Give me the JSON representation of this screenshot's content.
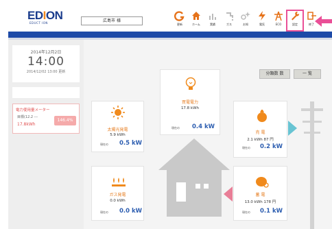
{
  "header": {
    "logo_ed": "ED",
    "logo_i": "I",
    "logo_on": "ON",
    "logo_sub": "EDUCT ION",
    "place": "広島市 様"
  },
  "nav": [
    {
      "icon": "g-refresh-icon",
      "label": "更新"
    },
    {
      "icon": "home-icon",
      "label": "ホーム"
    },
    {
      "icon": "graph-icon",
      "label": "実績"
    },
    {
      "icon": "tap-icon",
      "label": "ガス"
    },
    {
      "icon": "sparkle-icon",
      "label": "お知"
    },
    {
      "icon": "lightning-icon",
      "label": "電気"
    },
    {
      "icon": "tower-icon",
      "label": "ECO"
    },
    {
      "icon": "wrench-icon",
      "label": "設定"
    },
    {
      "icon": "exit-icon",
      "label": "終了"
    }
  ],
  "clock": {
    "date": "2014年12月2日",
    "time": "14:00",
    "updated": "2014/12/02 13:00 更新"
  },
  "meter": {
    "title": "電力使用量メーター",
    "line1": "目標(12.2 ---",
    "line2": "17.8kWh",
    "badge": "146.4%"
  },
  "buttons": {
    "detail": "分類数 数",
    "list": "一 覧"
  },
  "cards": {
    "solar": {
      "title": "太陽光発電",
      "kwh": "5.9 kWh",
      "meta": "現在の",
      "kw": "0.5 kW"
    },
    "buy": {
      "title": "買電電力",
      "kwh": "17.8 kWh",
      "meta": "現在の",
      "kw": "0.4 kW"
    },
    "sell": {
      "title": "売 電",
      "kwh": "2.1 kWh 87 円",
      "meta": "現在の",
      "kw": "0.2 kW"
    },
    "gas": {
      "title": "ガス発電",
      "kwh": "0.0 kWh",
      "meta": "現在の",
      "kw": "0.0 kW"
    },
    "store": {
      "title": "蓄 電",
      "kwh": "13.0 kWh 178 円",
      "meta": "現在の",
      "kw": "0.1 kW"
    }
  },
  "colors": {
    "blue": "#1d4aa7",
    "orange": "#e67e22",
    "pink": "#ea4f97",
    "teal": "#68c4d3"
  }
}
